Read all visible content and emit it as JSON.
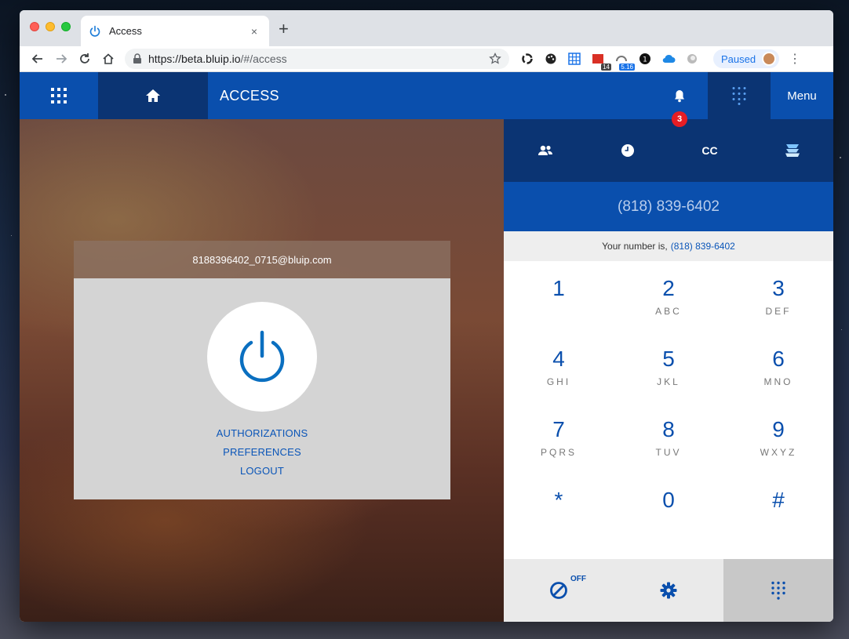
{
  "browser": {
    "tab_title": "Access",
    "new_tab": "+",
    "close": "×",
    "url_host": "https://beta.bluip.io",
    "url_path": "/#/access",
    "profile_label": "Paused",
    "ext_badge_1": "14",
    "ext_badge_2": "5.16"
  },
  "header": {
    "title": "ACCESS",
    "notification_count": "3",
    "menu_label": "Menu"
  },
  "account": {
    "email": "8188396402_0715@bluip.com",
    "links": [
      "AUTHORIZATIONS",
      "PREFERENCES",
      "LOGOUT"
    ]
  },
  "dialer": {
    "tools": {
      "cc_label": "CC"
    },
    "number_value": "(818) 839-6402",
    "your_number_prefix": "Your number is,",
    "your_number": "(818) 839-6402",
    "keys": [
      {
        "digit": "1",
        "letters": ""
      },
      {
        "digit": "2",
        "letters": "ABC"
      },
      {
        "digit": "3",
        "letters": "DEF"
      },
      {
        "digit": "4",
        "letters": "GHI"
      },
      {
        "digit": "5",
        "letters": "JKL"
      },
      {
        "digit": "6",
        "letters": "MNO"
      },
      {
        "digit": "7",
        "letters": "PQRS"
      },
      {
        "digit": "8",
        "letters": "TUV"
      },
      {
        "digit": "9",
        "letters": "WXYZ"
      },
      {
        "digit": "*",
        "letters": ""
      },
      {
        "digit": "0",
        "letters": ""
      },
      {
        "digit": "#",
        "letters": ""
      }
    ],
    "dnd_state": "OFF"
  },
  "colors": {
    "primary": "#0a4fad",
    "primary_dark": "#0b3473",
    "badge_red": "#e61d24"
  }
}
